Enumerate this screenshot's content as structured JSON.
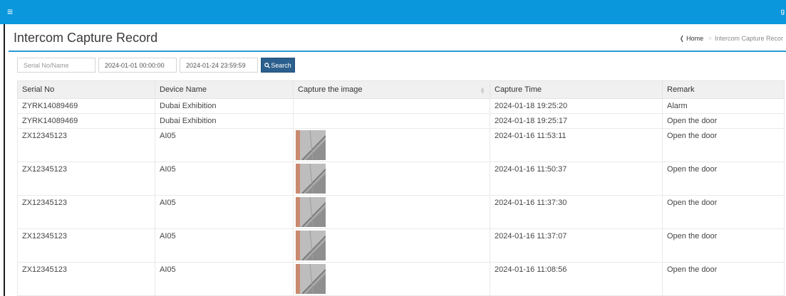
{
  "topbar": {
    "menu_icon": "hamburger-icon",
    "user_initial": "g",
    "color": "#0a97db"
  },
  "page": {
    "title": "Intercom Capture Record"
  },
  "breadcrumb": {
    "home_icon": "home-icon",
    "home": "Home",
    "current": "Intercom Capture Recor"
  },
  "filters": {
    "serial_placeholder": "Serial No/Name",
    "start_time": "2024-01-01 00:00:00",
    "end_time": "2024-01-24 23:59:59",
    "search_label": "Search",
    "search_icon": "search-icon"
  },
  "table": {
    "columns": [
      "Serial No",
      "Device Name",
      "Capture the image",
      "Capture Time",
      "Remark"
    ],
    "rows": [
      {
        "serial": "ZYRK14089469",
        "device": "Dubai Exhibition",
        "has_image": false,
        "time": "2024-01-18 19:25:20",
        "remark": "Alarm"
      },
      {
        "serial": "ZYRK14089469",
        "device": "Dubai Exhibition",
        "has_image": false,
        "time": "2024-01-18 19:25:17",
        "remark": "Open the door"
      },
      {
        "serial": "ZX12345123",
        "device": "AI05",
        "has_image": true,
        "time": "2024-01-16 11:53:11",
        "remark": "Open the door"
      },
      {
        "serial": "ZX12345123",
        "device": "AI05",
        "has_image": true,
        "time": "2024-01-16 11:50:37",
        "remark": "Open the door"
      },
      {
        "serial": "ZX12345123",
        "device": "AI05",
        "has_image": true,
        "time": "2024-01-16 11:37:30",
        "remark": "Open the door"
      },
      {
        "serial": "ZX12345123",
        "device": "AI05",
        "has_image": true,
        "time": "2024-01-16 11:37:07",
        "remark": "Open the door"
      },
      {
        "serial": "ZX12345123",
        "device": "AI05",
        "has_image": true,
        "time": "2024-01-16 11:08:56",
        "remark": "Open the door"
      }
    ]
  }
}
